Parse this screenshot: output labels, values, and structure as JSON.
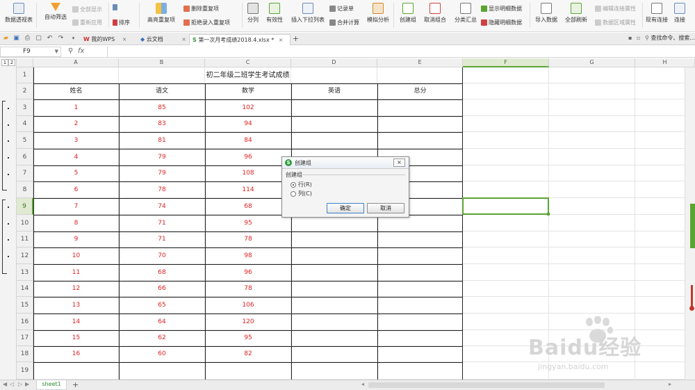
{
  "ribbon": {
    "pivot": "数据透视表",
    "autofilter": "自动筛选",
    "show_all": "全部显示",
    "reapply": "重新应用",
    "sort": "排序",
    "highlight_dup": "高亮重复项",
    "delete_dup": "删除重复项",
    "reject_dup": "拒绝录入重复项",
    "split": "分列",
    "validity": "有效性",
    "dropdown_list": "插入下拉列表",
    "record": "记录单",
    "merge_calc": "合并计算",
    "simulate": "模拟分析",
    "create_group": "创建组",
    "ungroup": "取消组合",
    "subtotal": "分类汇总",
    "show_detail": "显示明细数据",
    "hide_detail": "隐藏明细数据",
    "import": "导入数据",
    "refresh_all": "全部刷新",
    "edit_links": "编辑连接属性",
    "area_props": "数据区域属性",
    "existing_conn": "现有连接",
    "connect": "连接"
  },
  "tabs": {
    "mywps": "我的WPS",
    "cloud": "云文档",
    "active_doc": "第一次月考成绩2018.4.xlsx *",
    "add": "+",
    "search": "查找命令、搜索..."
  },
  "formula_bar": {
    "name_box": "F9",
    "fx": "fx",
    "value": ""
  },
  "outline_levels": [
    "1",
    "2"
  ],
  "columns": [
    "A",
    "B",
    "C",
    "D",
    "E",
    "F",
    "G",
    "H"
  ],
  "rows": [
    "1",
    "2",
    "3",
    "4",
    "5",
    "6",
    "7",
    "8",
    "9",
    "10",
    "11",
    "12",
    "13",
    "14",
    "15",
    "16",
    "17",
    "18",
    "19"
  ],
  "sheet": {
    "title": "初二年级二班学生考试成绩",
    "headers": [
      "姓名",
      "语文",
      "数学",
      "英语",
      "总分"
    ],
    "data": [
      [
        "1",
        "85",
        "102"
      ],
      [
        "2",
        "83",
        "94"
      ],
      [
        "3",
        "81",
        "84"
      ],
      [
        "4",
        "79",
        "96"
      ],
      [
        "5",
        "79",
        "108"
      ],
      [
        "6",
        "78",
        "114"
      ],
      [
        "7",
        "74",
        "68"
      ],
      [
        "8",
        "71",
        "95"
      ],
      [
        "9",
        "71",
        "78"
      ],
      [
        "10",
        "70",
        "98"
      ],
      [
        "11",
        "68",
        "96"
      ],
      [
        "12",
        "66",
        "78"
      ],
      [
        "13",
        "65",
        "106"
      ],
      [
        "14",
        "64",
        "120"
      ],
      [
        "15",
        "62",
        "95"
      ],
      [
        "16",
        "60",
        "82"
      ]
    ]
  },
  "sheet_tab": "sheet1",
  "dialog": {
    "title": "创建组",
    "close": "×",
    "group_label": "创建组",
    "option_row": "行(R)",
    "option_col": "列(C)",
    "ok": "确定",
    "cancel": "取消"
  },
  "watermark": {
    "main": "Baidu经验",
    "sub": "jingyan.baidu.com"
  },
  "colors": {
    "accent": "#5aa532",
    "data_red": "#e02020"
  }
}
